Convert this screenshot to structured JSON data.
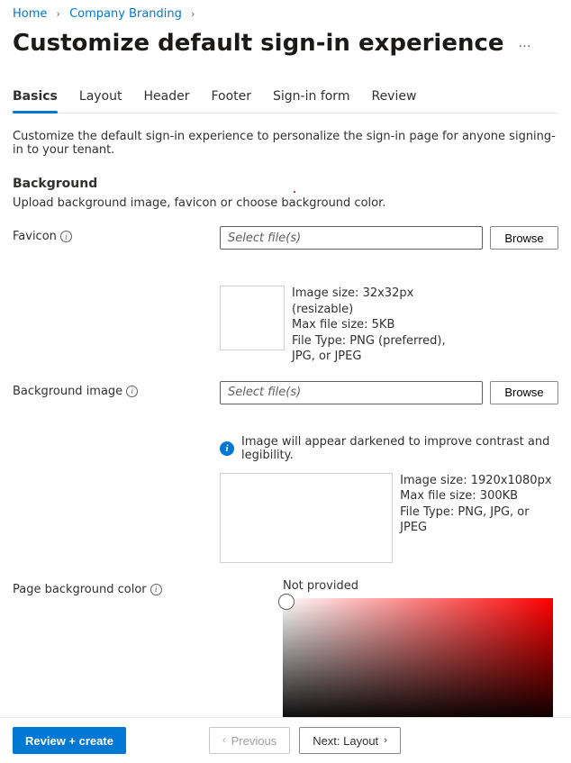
{
  "breadcrumb": {
    "items": [
      {
        "label": "Home"
      },
      {
        "label": "Company Branding"
      }
    ]
  },
  "page": {
    "title": "Customize default sign-in experience",
    "more": "…"
  },
  "tabs": {
    "items": [
      {
        "label": "Basics"
      },
      {
        "label": "Layout"
      },
      {
        "label": "Header"
      },
      {
        "label": "Footer"
      },
      {
        "label": "Sign-in form"
      },
      {
        "label": "Review"
      }
    ]
  },
  "basics": {
    "description": "Customize the default sign-in experience to personalize the sign-in page for anyone signing-in to your tenant.",
    "background_heading": "Background",
    "background_sub": "Upload background image, favicon or choose background color.",
    "favicon_label": "Favicon",
    "favicon_placeholder": "Select file(s)",
    "favicon_browse": "Browse",
    "favicon_hint_l1": "Image size: 32x32px",
    "favicon_hint_l2": "(resizable)",
    "favicon_hint_l3": "Max file size: 5KB",
    "favicon_hint_l4": "File Type: PNG (preferred),",
    "favicon_hint_l5": "JPG, or JPEG",
    "bgimage_label": "Background image",
    "bgimage_placeholder": "Select file(s)",
    "bgimage_browse": "Browse",
    "bgimage_callout": "Image will appear darkened to improve contrast and legibility.",
    "bgimage_hint_l1": "Image size: 1920x1080px",
    "bgimage_hint_l2": "Max file size: 300KB",
    "bgimage_hint_l3": "File Type: PNG, JPG, or JPEG",
    "color_label": "Page background color",
    "color_value": "Not provided"
  },
  "footer": {
    "review_create": "Review + create",
    "previous": "Previous",
    "next": "Next: Layout"
  }
}
